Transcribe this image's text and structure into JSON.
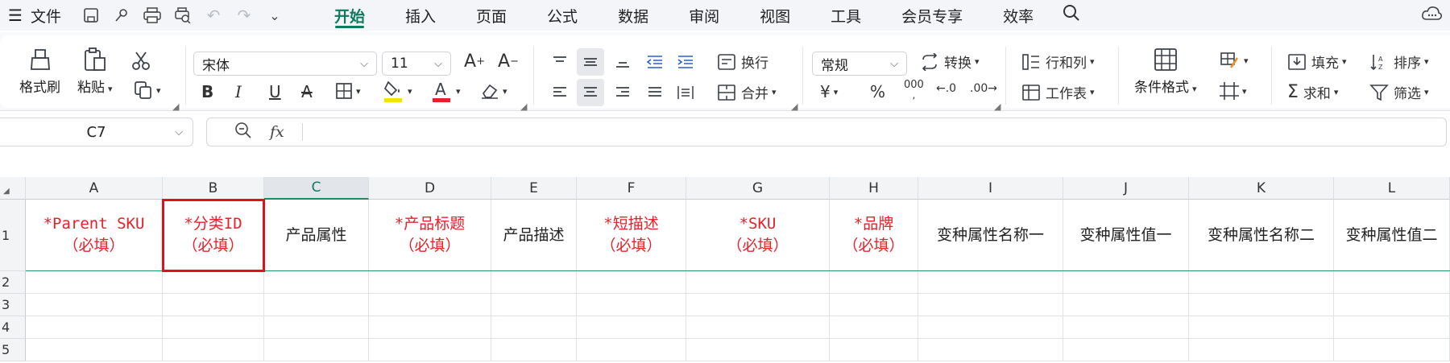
{
  "menubar": {
    "hamburger_icon": "menu-icon",
    "file_label": "文件",
    "tabs": [
      {
        "label": "开始",
        "active": true
      },
      {
        "label": "插入"
      },
      {
        "label": "页面"
      },
      {
        "label": "公式"
      },
      {
        "label": "数据"
      },
      {
        "label": "审阅"
      },
      {
        "label": "视图"
      },
      {
        "label": "工具"
      },
      {
        "label": "会员专享"
      },
      {
        "label": "效率"
      }
    ]
  },
  "ribbon": {
    "format_painter": "格式刷",
    "paste": "粘贴",
    "font_name": "宋体",
    "font_size": "11",
    "wrap": "换行",
    "merge": "合并",
    "number_format": "常规",
    "convert": "转换",
    "rows_cols": "行和列",
    "worksheet": "工作表",
    "conditional_format": "条件格式",
    "fill": "填充",
    "sort": "排序",
    "sum": "求和",
    "filter": "筛选",
    "currency_symbol": "¥",
    "percent_symbol": "%",
    "thousands_symbol": "000",
    "bold": "B",
    "italic": "I",
    "underline": "U",
    "strike": "A",
    "font_color": "A",
    "accent_color": "#0e7a5e",
    "highlight_color": "#f5e400",
    "font_color_bar": "#e8202a"
  },
  "formula_bar": {
    "cell_ref": "C7",
    "fx_label": "fx",
    "formula": ""
  },
  "sheet": {
    "columns": [
      "A",
      "B",
      "C",
      "D",
      "E",
      "F",
      "G",
      "H",
      "I",
      "J",
      "K",
      "L"
    ],
    "selected_column": "C",
    "rows": [
      "1",
      "2",
      "3",
      "4",
      "5"
    ],
    "header_row": [
      {
        "line1": "*Parent SKU",
        "line2": "（必填）",
        "required": true
      },
      {
        "line1": "*分类ID",
        "line2": "（必填）",
        "required": true
      },
      {
        "line1": "产品属性",
        "line2": "",
        "required": false
      },
      {
        "line1": "*产品标题",
        "line2": "（必填）",
        "required": true
      },
      {
        "line1": "产品描述",
        "line2": "",
        "required": false
      },
      {
        "line1": "*短描述",
        "line2": "（必填）",
        "required": true
      },
      {
        "line1": "*SKU",
        "line2": "（必填）",
        "required": true
      },
      {
        "line1": "*品牌",
        "line2": "（必填）",
        "required": true
      },
      {
        "line1": "变种属性名称一",
        "line2": "",
        "required": false
      },
      {
        "line1": "变种属性值一",
        "line2": "",
        "required": false
      },
      {
        "line1": "变种属性名称二",
        "line2": "",
        "required": false
      },
      {
        "line1": "变种属性值二",
        "line2": "",
        "required": false
      }
    ],
    "highlight_box_color": "#e0101e",
    "required_text_color": "#e8202a"
  }
}
